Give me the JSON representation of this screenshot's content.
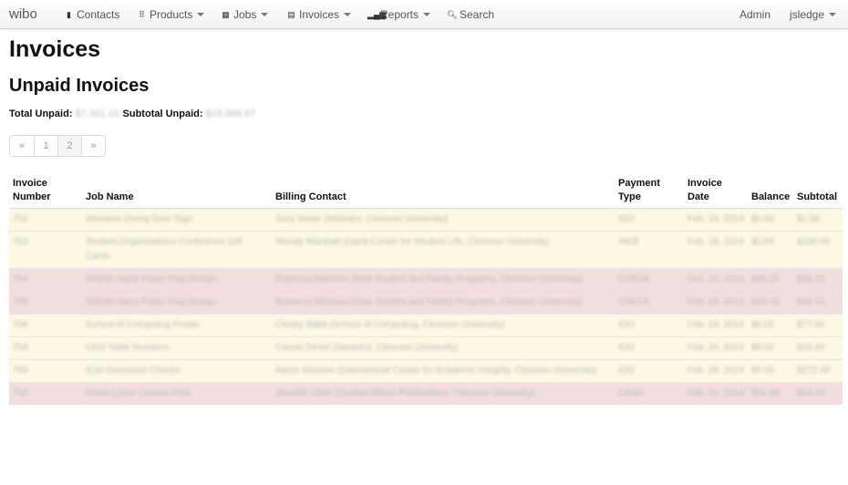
{
  "nav": {
    "brand": "wibo",
    "contacts": "Contacts",
    "products": "Products",
    "jobs": "Jobs",
    "invoices": "Invoices",
    "reports": "Reports",
    "search": "Search",
    "admin": "Admin",
    "user": "jsledge"
  },
  "page": {
    "title": "Invoices",
    "subtitle": "Unpaid Invoices",
    "total_unpaid_label": "Total Unpaid:",
    "total_unpaid_value": "$7,301.01",
    "subtotal_unpaid_label": "Subtotal Unpaid:",
    "subtotal_unpaid_value": "$15,966.67"
  },
  "pagination": {
    "prev": "«",
    "p1": "1",
    "p2": "2",
    "next": "»"
  },
  "table": {
    "headers": {
      "invoice_number": "Invoice Number",
      "job_name": "Job Name",
      "billing_contact": "Billing Contact",
      "payment_type": "Payment Type",
      "invoice_date": "Invoice Date",
      "balance": "Balance",
      "subtotal": "Subtotal"
    },
    "rows": [
      {
        "status": "warning",
        "num": "752",
        "job": "Womens Diving Door Sign",
        "contact": "Gary Wade (Athletics, Clemson University)",
        "pay": "IDO",
        "date": "Feb. 18, 2014",
        "balance": "$0.00",
        "subtotal": "$2.58"
      },
      {
        "status": "warning",
        "num": "753",
        "job": "Student Organizations Conference Gift Cards",
        "contact": "Wendy Marshall (Gantt Center for Student Life, Clemson University)",
        "pay": "WEB",
        "date": "Feb. 18, 2014",
        "balance": "$0.00",
        "subtotal": "$100.00"
      },
      {
        "status": "error",
        "num": "754",
        "job": "SROW Harry Potter Flag Design",
        "contact": "Rebecca Atkinson (New Student and Family Programs, Clemson University)",
        "pay": "CHECK",
        "date": "Feb. 18, 2014",
        "balance": "$48.15",
        "subtotal": "$48.15"
      },
      {
        "status": "error",
        "num": "755",
        "job": "SROW Harry Potter Flag Design",
        "contact": "Rebecca Atkinson (New Student and Family Programs, Clemson University)",
        "pay": "CHECK",
        "date": "Feb. 18, 2014",
        "balance": "$48.15",
        "subtotal": "$48.15"
      },
      {
        "status": "warning",
        "num": "756",
        "job": "School of Computing Poster",
        "contact": "Christy Babb (School of Computing, Clemson University)",
        "pay": "IDO",
        "date": "Feb. 19, 2014",
        "balance": "$0.00",
        "subtotal": "$77.00"
      },
      {
        "status": "warning",
        "num": "758",
        "job": "CEO Table Numbers",
        "contact": "Cassie DeVol (Genetics, Clemson University)",
        "pay": "IDO",
        "date": "Feb. 20, 2014",
        "balance": "$0.00",
        "subtotal": "$15.60"
      },
      {
        "status": "warning",
        "num": "759",
        "job": "ICAI Oversized Checks",
        "contact": "Aaron Monson (International Center for Academic Integrity, Clemson University)",
        "pay": "IDO",
        "date": "Feb. 20, 2014",
        "balance": "$0.00",
        "subtotal": "$272.00"
      },
      {
        "status": "error",
        "num": "760",
        "job": "Photo Lyrics Canvas Print",
        "contact": "Jennifer Clark (Student Affairs Publications, Clemson University)",
        "pay": "CASH",
        "date": "Feb. 20, 2014",
        "balance": "$54.39",
        "subtotal": "$54.39"
      }
    ]
  }
}
